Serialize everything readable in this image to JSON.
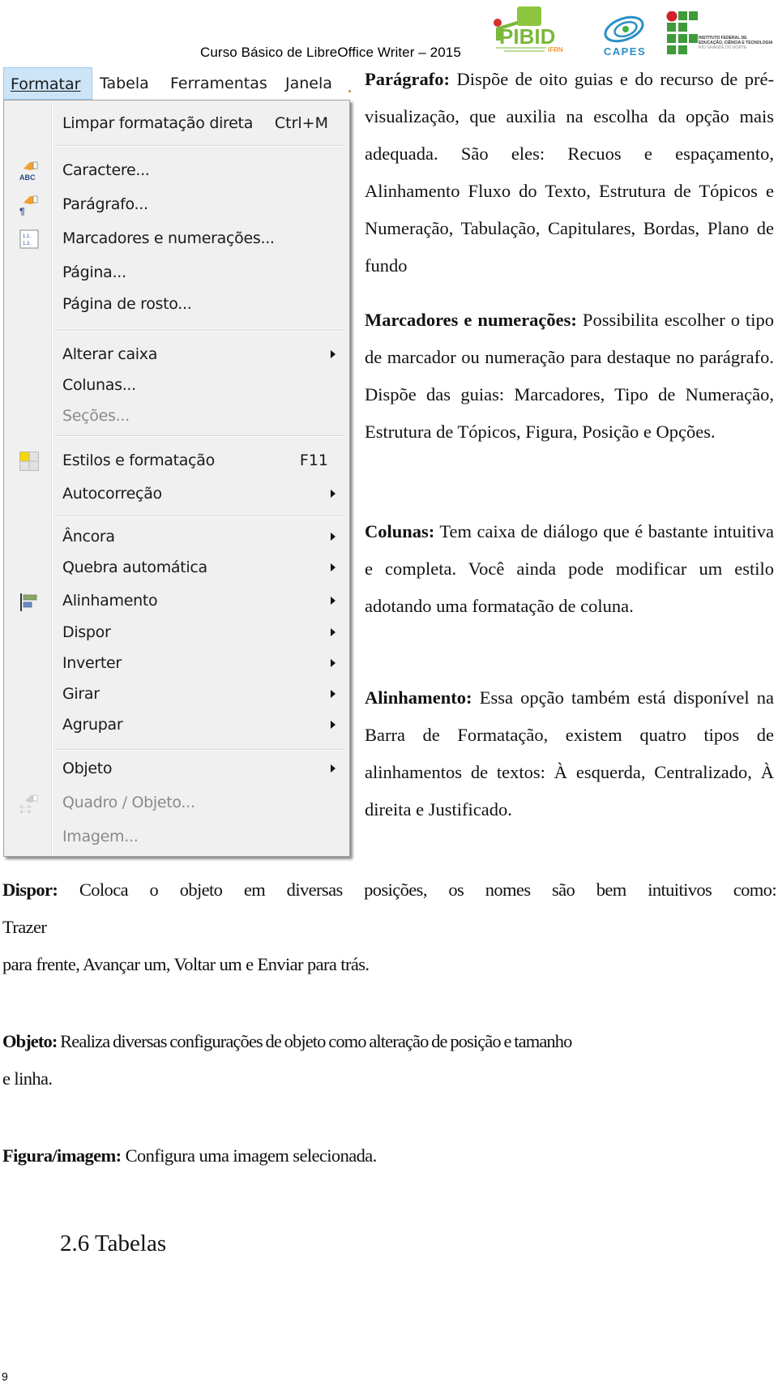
{
  "header": {
    "title": "Curso Básico de LibreOffice Writer – 2015",
    "logos": [
      {
        "name": "pibid-logo",
        "text": "PIBID",
        "subtext": "IFRN"
      },
      {
        "name": "capes-logo",
        "text": "CAPES"
      },
      {
        "name": "ifrn-logo",
        "lines": [
          "INSTITUTO FEDERAL DE",
          "EDUCAÇÃO, CIÊNCIA E TECNOLOGIA",
          "RIO GRANDE DO NORTE"
        ]
      }
    ],
    "colors": {
      "pibid_green": "#7ab83a",
      "capes_blue": "#2a8fc7",
      "ifrn_green": "#3f9a3a",
      "ifrn_red": "#d0202a"
    }
  },
  "menubar": {
    "items": [
      {
        "label": "Formatar",
        "mnemonic": "F",
        "active": true
      },
      {
        "label": "Tabela",
        "mnemonic": "T"
      },
      {
        "label": "Ferramentas",
        "mnemonic": "r"
      },
      {
        "label": "Janela",
        "mnemonic": "J"
      }
    ]
  },
  "menu": {
    "items": [
      {
        "label": "Limpar formatação direta",
        "shortcut": "Ctrl+M",
        "icon": null,
        "submenu": false,
        "disabled": false
      },
      {
        "label": "Caractere...",
        "icon": "character-icon",
        "submenu": false,
        "disabled": false
      },
      {
        "label": "Parágrafo...",
        "icon": "paragraph-icon",
        "submenu": false,
        "disabled": false
      },
      {
        "label": "Marcadores e numerações...",
        "icon": "bullets-numbering-icon",
        "submenu": false,
        "disabled": false
      },
      {
        "label": "Página...",
        "icon": null,
        "submenu": false,
        "disabled": false
      },
      {
        "label": "Página de rosto...",
        "icon": null,
        "submenu": false,
        "disabled": false
      },
      {
        "label": "Alterar caixa",
        "icon": null,
        "submenu": true,
        "disabled": false
      },
      {
        "label": "Colunas...",
        "icon": null,
        "submenu": false,
        "disabled": false
      },
      {
        "label": "Seções...",
        "icon": null,
        "submenu": false,
        "disabled": true
      },
      {
        "label": "Estilos e formatação",
        "shortcut": "F11",
        "icon": "styles-icon",
        "submenu": false,
        "disabled": false
      },
      {
        "label": "Autocorreção",
        "icon": null,
        "submenu": true,
        "disabled": false
      },
      {
        "label": "Âncora",
        "icon": null,
        "submenu": true,
        "disabled": false
      },
      {
        "label": "Quebra automática",
        "icon": null,
        "submenu": true,
        "disabled": false
      },
      {
        "label": "Alinhamento",
        "icon": "alignment-icon",
        "submenu": true,
        "disabled": false
      },
      {
        "label": "Dispor",
        "icon": null,
        "submenu": true,
        "disabled": false
      },
      {
        "label": "Inverter",
        "icon": null,
        "submenu": true,
        "disabled": false
      },
      {
        "label": "Girar",
        "icon": null,
        "submenu": true,
        "disabled": false
      },
      {
        "label": "Agrupar",
        "icon": null,
        "submenu": true,
        "disabled": false
      },
      {
        "label": "Objeto",
        "icon": null,
        "submenu": true,
        "disabled": false
      },
      {
        "label": "Quadro / Objeto...",
        "icon": "frame-object-icon",
        "submenu": false,
        "disabled": true
      },
      {
        "label": "Imagem...",
        "icon": null,
        "submenu": false,
        "disabled": true
      }
    ]
  },
  "content": {
    "paragrafo": {
      "term": "Parágrafo:",
      "text": " Dispõe de oito guias e do recurso de pré-visualização, que auxilia na escolha da opção mais adequada. São eles: Recuos e espaçamento, Alinhamento Fluxo do Texto, Estrutura de Tópicos e Numeração, Tabulação, Capitulares, Bordas, Plano de fundo"
    },
    "marcadores": {
      "term": "Marcadores e numerações:",
      "text": " Possibilita escolher o tipo de marcador ou numeração para destaque no parágrafo. Dispõe das guias: Marcadores, Tipo de Numeração, Estrutura de Tópicos, Figura, Posição e Opções."
    },
    "colunas": {
      "term": "Colunas:",
      "text": " Tem caixa de diálogo que é bastante intuitiva e completa. Você ainda pode modificar um estilo adotando uma formatação de coluna."
    },
    "alinhamento": {
      "term": "Alinhamento:",
      "text": " Essa opção também está disponível na Barra de Formatação, existem quatro tipos de alinhamentos de textos: À esquerda, Centralizado, À direita e Justificado."
    },
    "dispor": {
      "term": "Dispor:",
      "line1": " Coloca o objeto em diversas posições, os nomes são bem intuitivos como:",
      "line2": "Trazer",
      "line3": "para frente, Avançar um, Voltar um e Enviar para trás."
    },
    "objeto": {
      "term": "Objeto:",
      "line1": " Realiza diversas configurações de objeto como alteração de posição e tamanho",
      "line2": "e linha."
    },
    "figura": {
      "term": "Figura/imagem:",
      "text": " Configura uma imagem selecionada."
    },
    "section_heading": "2.6 Tabelas"
  },
  "footer": {
    "page_number": "9"
  }
}
